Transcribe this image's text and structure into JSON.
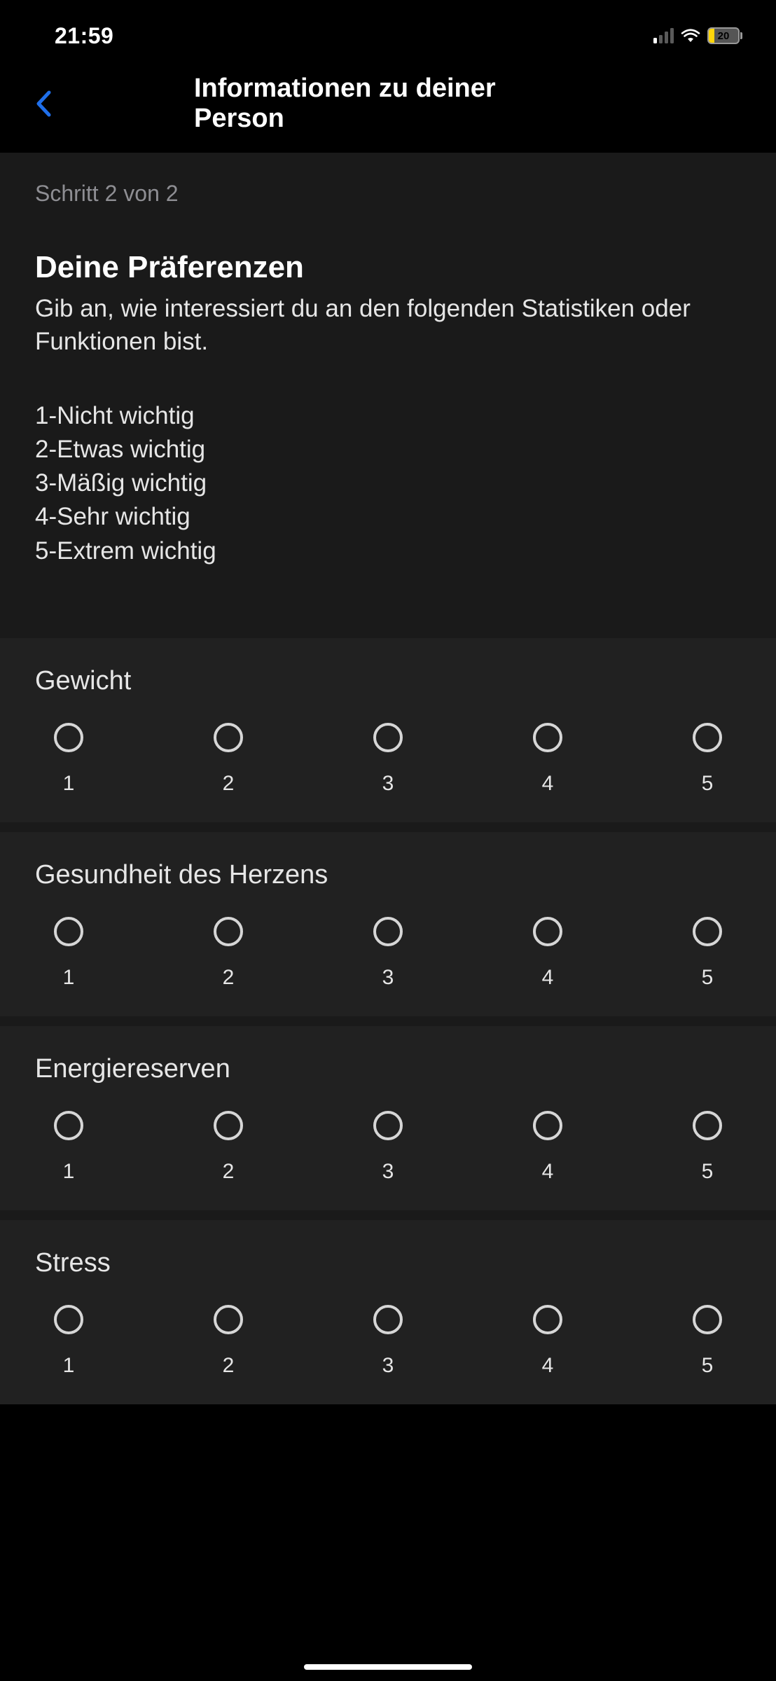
{
  "status_bar": {
    "time": "21:59",
    "battery_level": "20"
  },
  "nav": {
    "title": "Informationen zu deiner Person"
  },
  "intro": {
    "step": "Schritt 2 von 2",
    "title": "Deine Präferenzen",
    "description": "Gib an, wie interessiert du an den folgenden Statistiken oder Funktionen bist.",
    "scale": {
      "s1": "1-Nicht wichtig",
      "s2": "2-Etwas wichtig",
      "s3": "3-Mäßig wichtig",
      "s4": "4-Sehr wichtig",
      "s5": "5-Extrem wichtig"
    }
  },
  "questions": [
    {
      "label": "Gewicht",
      "options": [
        "1",
        "2",
        "3",
        "4",
        "5"
      ]
    },
    {
      "label": "Gesundheit des Herzens",
      "options": [
        "1",
        "2",
        "3",
        "4",
        "5"
      ]
    },
    {
      "label": "Energiereserven",
      "options": [
        "1",
        "2",
        "3",
        "4",
        "5"
      ]
    },
    {
      "label": "Stress",
      "options": [
        "1",
        "2",
        "3",
        "4",
        "5"
      ]
    }
  ]
}
